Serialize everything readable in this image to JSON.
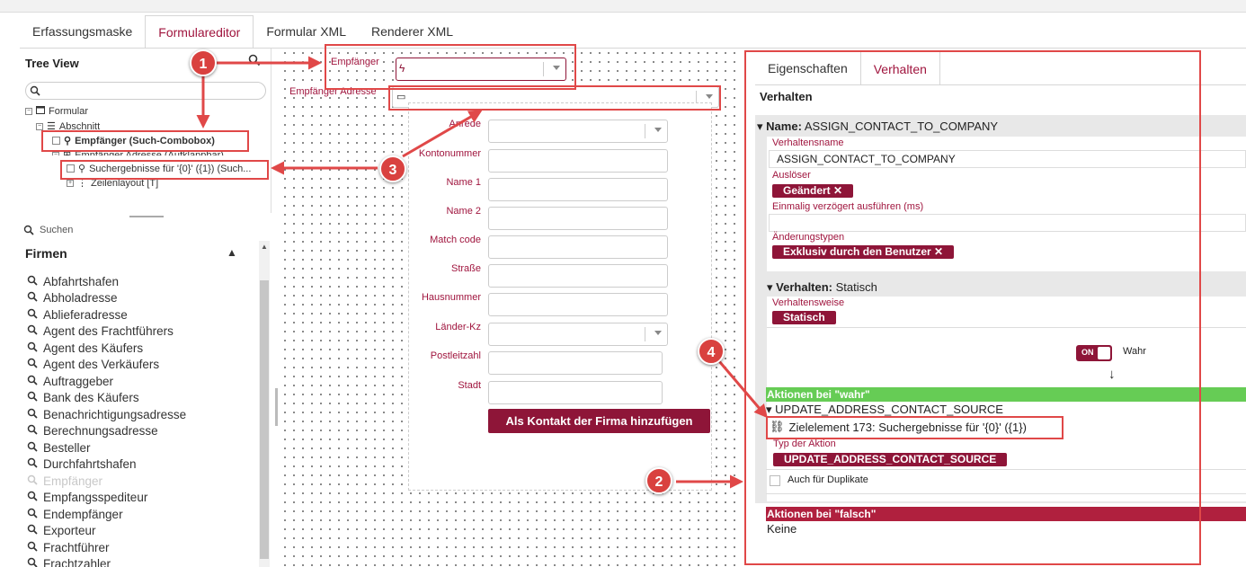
{
  "tabs": [
    "Erfassungsmaske",
    "Formulareditor",
    "Formular XML",
    "Renderer XML"
  ],
  "active_tab": "Formulareditor",
  "tree": {
    "title": "Tree View",
    "nodes": [
      "Formular",
      "Abschnitt",
      "Empfänger (Such-Combobox)",
      "Empfänger Adresse (Aufklappbar)",
      "Suchergebnisse für '{0}' ({1}) (Such...",
      "Zeilenlayout [T]"
    ]
  },
  "list": {
    "search_placeholder": "Suchen",
    "heading": "Firmen",
    "items": [
      "Abfahrtshafen",
      "Abholadresse",
      "Ablieferadresse",
      "Agent des Frachtführers",
      "Agent des Käufers",
      "Agent des Verkäufers",
      "Auftraggeber",
      "Bank des Käufers",
      "Benachrichtigungsadresse",
      "Berechnungsadresse",
      "Besteller",
      "Durchfahrtshafen",
      "Empfänger",
      "Empfangsspediteur",
      "Endempfänger",
      "Exporteur",
      "Frachtführer",
      "Frachtzahler"
    ],
    "disabled_item": "Empfänger"
  },
  "form": {
    "empfaenger_label": "Empfänger",
    "adresse_label": "Empfänger Adresse",
    "fields": [
      "Anrede",
      "Kontonummer",
      "Name 1",
      "Name 2",
      "Match code",
      "Straße",
      "Hausnummer",
      "Länder-Kz",
      "Postleitzahl",
      "Stadt"
    ],
    "submit": "Als Kontakt der Firma hinzufügen"
  },
  "right": {
    "tabs": [
      "Eigenschaften",
      "Verhalten"
    ],
    "active_tab": "Verhalten",
    "title": "Verhalten",
    "name_label": "Name:",
    "name_value": "ASSIGN_CONTACT_TO_COMPANY",
    "verhaltensname_label": "Verhaltensname",
    "verhaltensname_value": "ASSIGN_CONTACT_TO_COMPANY",
    "ausloeser_label": "Auslöser",
    "ausloeser_chip": "Geändert ✕",
    "verzoegert_label": "Einmalig verzögert ausführen (ms)",
    "aenderungstypen_label": "Änderungstypen",
    "aenderungstypen_chip": "Exklusiv durch den Benutzer ✕",
    "verhalten_label": "Verhalten:",
    "verhalten_value": "Statisch",
    "verhaltensweise_label": "Verhaltensweise",
    "verhaltensweise_chip": "Statisch",
    "toggle_on": "ON",
    "toggle_label": "Wahr",
    "arrow": "↓",
    "aktionen_wahr": "Aktionen bei \"wahr\"",
    "action_name": "UPDATE_ADDRESS_CONTACT_SOURCE",
    "zielelement": "Zielelement 173: Suchergebnisse für '{0}' ({1})",
    "typ_label": "Typ der Aktion",
    "typ_chip": "UPDATE_ADDRESS_CONTACT_SOURCE",
    "duplikate_label": "Auch für Duplikate",
    "aktionen_falsch": "Aktionen bei \"falsch\"",
    "keine": "Keine"
  },
  "markers": [
    "1",
    "2",
    "3",
    "4"
  ],
  "colors": {
    "accent": "#a0153e",
    "chip": "#8e1538",
    "annotation": "#e04848",
    "green": "#66cc55",
    "red": "#b0203e"
  }
}
